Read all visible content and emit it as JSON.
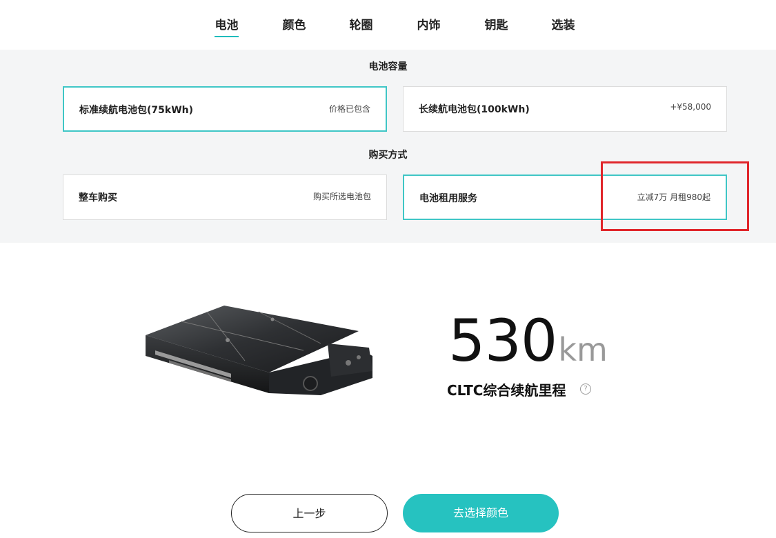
{
  "tabs": [
    {
      "label": "电池",
      "active": true
    },
    {
      "label": "颜色",
      "active": false
    },
    {
      "label": "轮圈",
      "active": false
    },
    {
      "label": "内饰",
      "active": false
    },
    {
      "label": "钥匙",
      "active": false
    },
    {
      "label": "选装",
      "active": false
    }
  ],
  "capacity": {
    "title": "电池容量",
    "options": [
      {
        "name": "标准续航电池包(75kWh)",
        "note": "价格已包含",
        "selected": true
      },
      {
        "name": "长续航电池包(100kWh)",
        "note": "+¥58,000",
        "selected": false
      }
    ]
  },
  "purchase": {
    "title": "购买方式",
    "options": [
      {
        "name": "整车购买",
        "note": "购买所选电池包",
        "selected": false
      },
      {
        "name": "电池租用服务",
        "note": "立减7万 月租980起",
        "selected": true
      }
    ]
  },
  "range": {
    "value": "530",
    "unit": "km",
    "label": "CLTC综合续航里程",
    "help_icon": "?"
  },
  "buttons": {
    "prev": "上一步",
    "next": "去选择颜色"
  },
  "colors": {
    "accent": "#26c2c0",
    "highlight": "#e0262b"
  }
}
